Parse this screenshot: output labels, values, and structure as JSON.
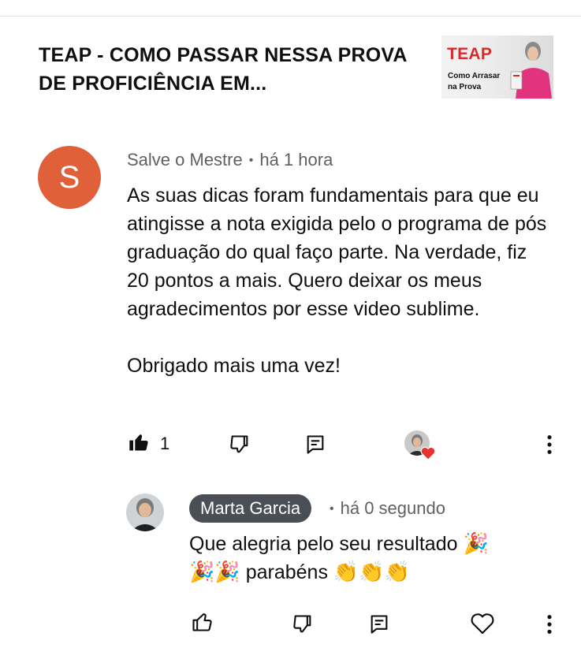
{
  "video": {
    "title": "TEAP - COMO PASSAR NESSA PROVA DE PROFICIÊNCIA EM...",
    "thumbnail": {
      "title": "TEAP",
      "subtitle_line1": "Como Arrasar",
      "subtitle_line2": "na Prova"
    }
  },
  "comment": {
    "avatar_letter": "S",
    "avatar_color": "#e0603a",
    "author": "Salve o Mestre",
    "separator": "•",
    "time": "há 1 hora",
    "paragraph1": "As suas dicas foram fundamentais para que eu atingisse a nota exigida pelo o programa de pós graduação do qual faço parte. Na verdade, fiz 20 pontos a mais. Quero deixar os meus agradecimentos por esse video sublime.",
    "paragraph2": "Obrigado mais uma vez!",
    "like_count": "1",
    "icons": [
      "thumbs-up-filled-icon",
      "thumbs-down-icon",
      "reply-icon",
      "creator-heart-icon",
      "more-vert-icon"
    ]
  },
  "reply": {
    "author": "Marta Garcia",
    "separator": "•",
    "time": "há 0 segundo",
    "text_part1": "Que alegria pelo seu resultado",
    "text_part2": "parabéns",
    "emoji_party": "🎉",
    "emoji_clap": "👏",
    "icons": [
      "thumbs-up-icon",
      "thumbs-down-icon",
      "reply-icon",
      "heart-outline-icon",
      "more-vert-icon"
    ]
  },
  "colors": {
    "chip_bg": "#4a4f56",
    "heart": "#e8322e",
    "thumb_red": "#d92b2b",
    "muted_text": "#606060"
  }
}
